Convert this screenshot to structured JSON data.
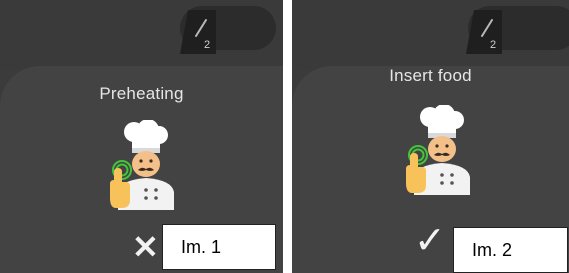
{
  "screens": [
    {
      "title": "Preheating",
      "action_icon": "close-icon",
      "action_glyph": "✕",
      "caption": "Im. 1",
      "probe_number": "2"
    },
    {
      "title": "Insert food",
      "action_icon": "checkmark-icon",
      "action_glyph": "✓",
      "caption": "Im. 2",
      "probe_number": "2"
    }
  ],
  "colors": {
    "background": "#3b3b3b",
    "card": "#434343",
    "text": "#e6e6e6",
    "chef_hat": "#ffffff",
    "chef_skin": "#f4c08a",
    "touch_ring": "#43c43a"
  }
}
